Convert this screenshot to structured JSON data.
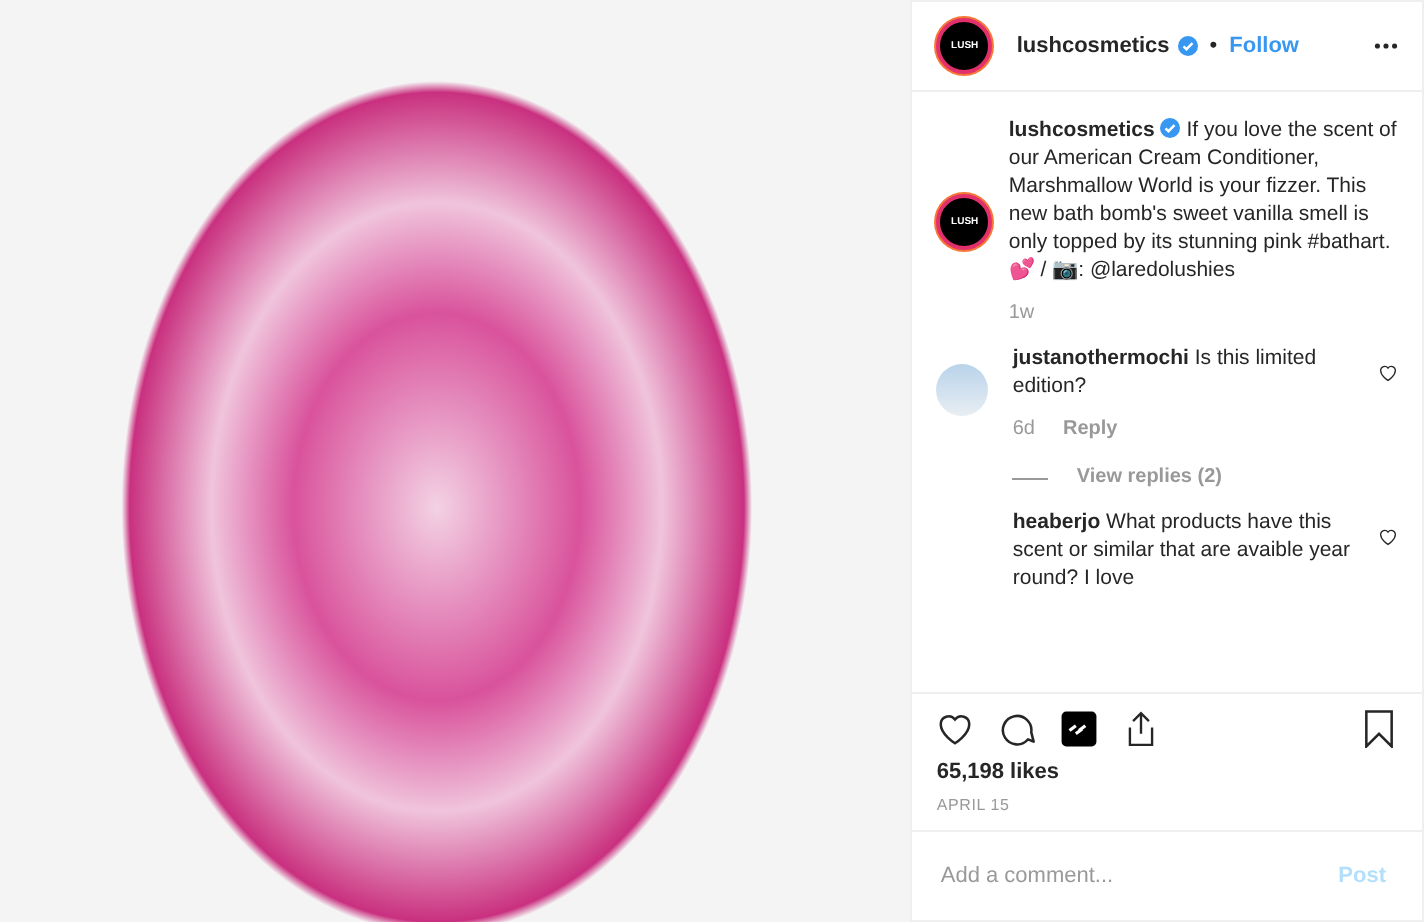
{
  "header": {
    "avatar_logo": "LUSH",
    "username": "lushcosmetics",
    "verified": true,
    "separator": "•",
    "follow": "Follow"
  },
  "caption": {
    "avatar_logo": "LUSH",
    "username": "lushcosmetics",
    "verified": true,
    "text": "If you love the scent of our American Cream Conditioner, Marshmallow World is your fizzer. This new bath bomb's sweet vanilla smell is only topped by its stunning pink #bathart. 💕 / 📷: @laredolushies",
    "time": "1w"
  },
  "comments": [
    {
      "username": "justanothermochi",
      "text": "Is this limited edition?",
      "avatar": true,
      "time": "6d",
      "reply": "Reply",
      "view_replies": "View replies (2)"
    },
    {
      "username": "heaberjo",
      "text": "What products have this scent or similar that are avaible year round? I love",
      "avatar": false
    }
  ],
  "likes": "65,198 likes",
  "date": "APRIL 15",
  "comment_box": {
    "placeholder": "Add a comment...",
    "post": "Post"
  }
}
